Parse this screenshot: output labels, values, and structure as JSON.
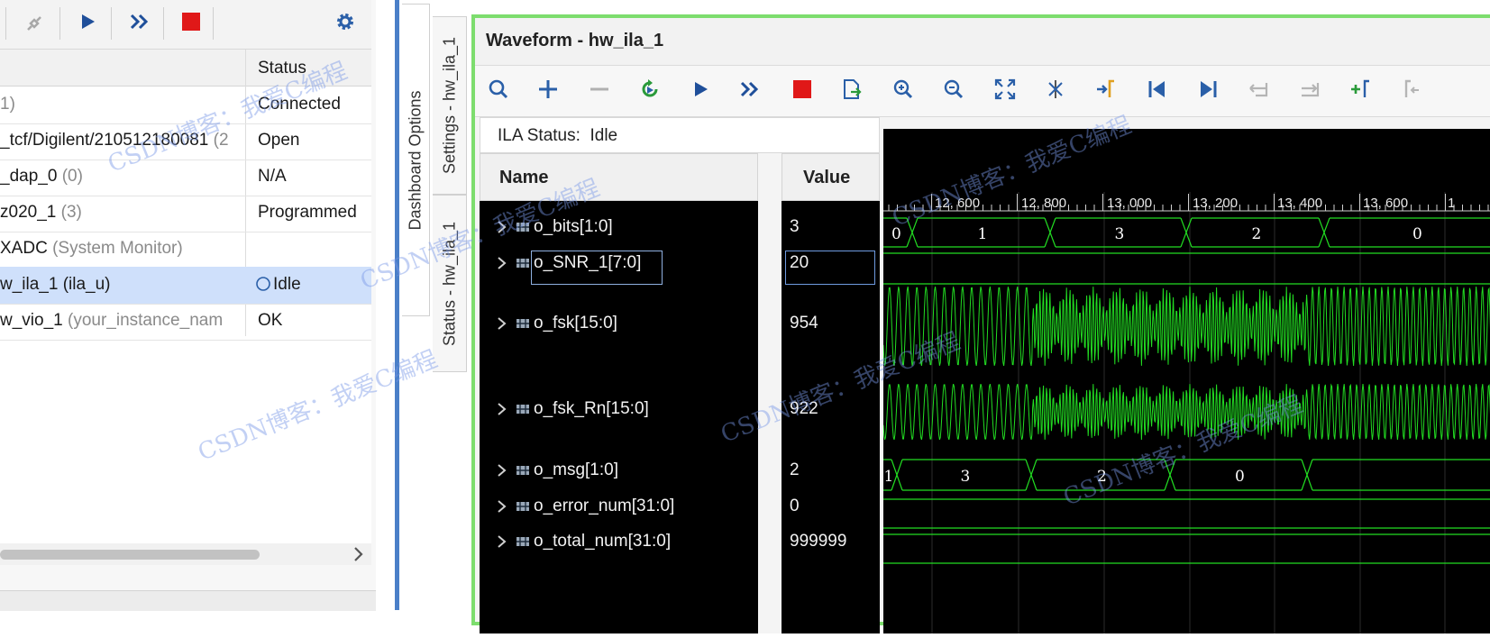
{
  "hardware_panel": {
    "toolbar_icons": [
      "disconnect-icon",
      "play-icon",
      "fast-forward-icon",
      "stop-icon",
      "gear-icon"
    ],
    "column_header": "Status",
    "rows": [
      {
        "name": "",
        "name_extra": "1)",
        "status": "Connected",
        "selected": false
      },
      {
        "name": "_tcf/Digilent/210512180081",
        "name_extra": "(2",
        "status": "Open",
        "selected": false
      },
      {
        "name": "_dap_0",
        "name_extra": "(0)",
        "status": "N/A",
        "selected": false
      },
      {
        "name": "z020_1",
        "name_extra": "(3)",
        "status": "Programmed",
        "selected": false
      },
      {
        "name": "XADC",
        "name_extra": "(System Monitor)",
        "status": "",
        "selected": false
      },
      {
        "name": "w_ila_1 (ila_u)",
        "name_extra": "",
        "status": "Idle",
        "selected": true
      },
      {
        "name": "w_vio_1",
        "name_extra": "(your_instance_nam",
        "status": "OK",
        "selected": false
      }
    ]
  },
  "vertical_tabs": {
    "dashboard": "Dashboard Options",
    "settings": "Settings - hw_ila_1",
    "status": "Status - hw_ila_1"
  },
  "waveform": {
    "title": "Waveform - hw_ila_1",
    "toolbar_icons": [
      "search-icon",
      "add-icon",
      "remove-icon",
      "refresh-icon",
      "play-icon",
      "fast-forward-icon",
      "stop-icon",
      "export-icon",
      "zoom-in-icon",
      "zoom-out-icon",
      "zoom-fit-icon",
      "cursor-icon",
      "go-to-marker-icon",
      "go-to-start-icon",
      "go-to-end-icon",
      "prev-transition-icon",
      "next-transition-icon",
      "add-marker-icon",
      "prev-marker-icon"
    ],
    "ila_status_label": "ILA Status:",
    "ila_status_value": "Idle",
    "name_header": "Name",
    "value_header": "Value",
    "signals": [
      {
        "name": "o_bits[1:0]",
        "value": "3"
      },
      {
        "name": "o_SNR_1[7:0]",
        "value": "20"
      },
      {
        "name": "o_fsk[15:0]",
        "value": "954"
      },
      {
        "name": "o_fsk_Rn[15:0]",
        "value": "922"
      },
      {
        "name": "o_msg[1:0]",
        "value": "2"
      },
      {
        "name": "o_error_num[31:0]",
        "value": "0"
      },
      {
        "name": "o_total_num[31:0]",
        "value": "999999"
      }
    ],
    "time_ticks": [
      "12, 600",
      "12, 800",
      "13, 000",
      "13, 200",
      "13, 400",
      "13, 600",
      "1"
    ],
    "bits_segments": [
      "0",
      "1",
      "3",
      "2",
      "0"
    ],
    "msg_segments": [
      "1",
      "3",
      "2",
      "0"
    ],
    "wave_color": "#22dd22"
  },
  "watermark_text": "CSDN博客：我爱C编程"
}
